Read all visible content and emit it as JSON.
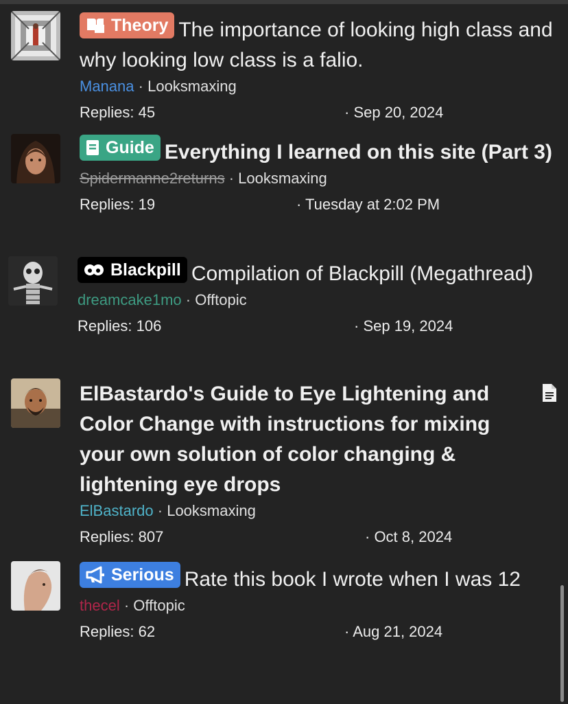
{
  "threads": [
    {
      "prefix": "Theory",
      "prefix_color": "#e27a63",
      "prefix_icon": "book-open-icon",
      "title": "The importance of looking high class and why looking low class is a falio.",
      "title_bold": false,
      "author": "Manana",
      "author_color": "#4a90e2",
      "forum": "Looksmaxing",
      "replies": "Replies: 45",
      "date": "· Sep 20, 2024"
    },
    {
      "prefix": "Guide",
      "prefix_color": "#3aa585",
      "prefix_icon": "book-icon",
      "title": "Everything I learned on this site (Part 3)",
      "title_bold": true,
      "author": "Spidermanne2returns",
      "author_color": "#9a9a9a",
      "forum": "Looksmaxing",
      "replies": "Replies: 19",
      "date": "· Tuesday at 2:02 PM"
    },
    {
      "prefix": "Blackpill",
      "prefix_color": "#000000",
      "prefix_icon": "pill-icon",
      "title": "Compilation of Blackpill (Megathread)",
      "title_bold": false,
      "author": "dreamcake1mo",
      "author_color": "#3e9b82",
      "forum": "Offtopic",
      "replies": "Replies: 106",
      "date": "· Sep 19, 2024"
    },
    {
      "prefix": "",
      "title": "ElBastardo's Guide to Eye Lightening and Color Change with instructions for mixing your own solution of color changing & lightening eye drops",
      "title_bold": true,
      "author": "ElBastardo",
      "author_color": "#4fb3c9",
      "forum": "Looksmaxing",
      "replies": "Replies: 807",
      "date": "· Oct 8, 2024"
    },
    {
      "prefix": "Serious",
      "prefix_color": "#3d7fe0",
      "prefix_icon": "megaphone-icon",
      "title": "Rate this book I wrote when I was 12",
      "title_bold": false,
      "author": "thecel",
      "author_color": "#b0264a",
      "forum": "Offtopic",
      "replies": "Replies: 62",
      "date": "· Aug 21, 2024"
    }
  ],
  "icons": {
    "document": "document-icon"
  }
}
